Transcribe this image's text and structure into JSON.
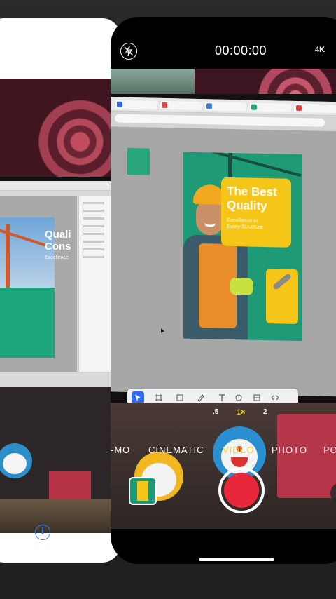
{
  "camera": {
    "timer": "00:00:00",
    "resolution": "4K",
    "flash_state": "off",
    "zoom_levels": [
      ".5",
      "1×",
      "2"
    ],
    "active_zoom": "1×",
    "modes": [
      "-MO",
      "CINEMATIC",
      "VIDEO",
      "PHOTO",
      "PO"
    ],
    "active_mode": "VIDEO",
    "record_color": "#e8283a",
    "accent_color": "#ffd60a"
  },
  "viewfinder": {
    "poster": {
      "title_line1": "The Best",
      "title_line2": "Quality",
      "subtitle_line1": "Excellence in",
      "subtitle_line2": "Every Structure",
      "bg_color": "#1f9a76",
      "accent": "#f5c518"
    }
  },
  "left_card": {
    "poster_title_line1": "Quali",
    "poster_title_line2": "Cons",
    "poster_sub": "Excellence",
    "info_icon": "info-icon"
  },
  "icons": {
    "flash": "flash-off-icon",
    "flip": "camera-flip-icon"
  }
}
